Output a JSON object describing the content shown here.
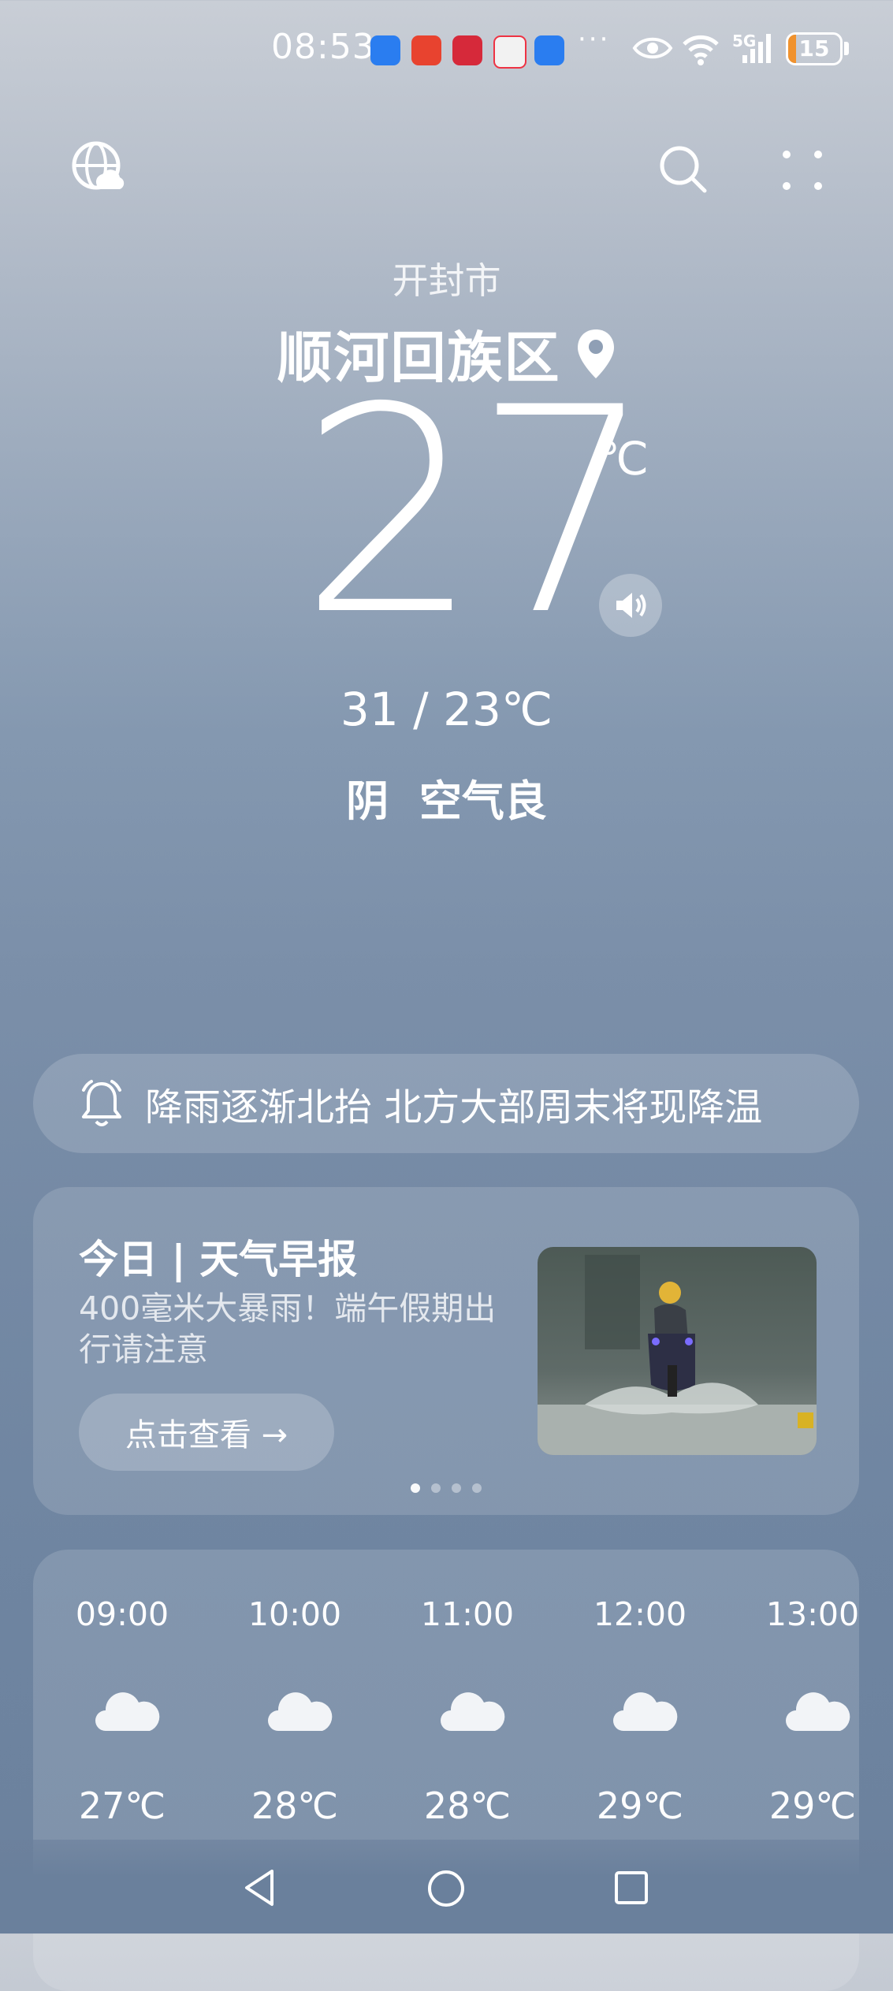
{
  "status_bar": {
    "time": "08:53",
    "more": "···",
    "network": "5G",
    "battery": "15",
    "battery_level": 0.15
  },
  "header": {
    "city": "开封市",
    "district": "顺河回族区",
    "temperature": "27",
    "temp_unit": "℃",
    "range": "31 / 23℃",
    "condition": "阴",
    "air_quality": "空气良"
  },
  "alert": {
    "text": "降雨逐渐北抬 北方大部周末将现降温"
  },
  "brief": {
    "title": "今日 | 天气早报",
    "subtitle": "400毫米大暴雨！端午假期出行请注意",
    "button": "点击查看 →",
    "page_count": 4,
    "active_page": 0
  },
  "hourly": [
    {
      "time": "09:00",
      "icon": "cloudy-icon",
      "temp": "27℃"
    },
    {
      "time": "10:00",
      "icon": "cloudy-icon",
      "temp": "28℃"
    },
    {
      "time": "11:00",
      "icon": "cloudy-icon",
      "temp": "28℃"
    },
    {
      "time": "12:00",
      "icon": "cloudy-icon",
      "temp": "29℃"
    },
    {
      "time": "13:00",
      "icon": "cloudy-icon",
      "temp": "29℃"
    }
  ],
  "colors": {
    "sky_top": "#c9ced6",
    "sky_bottom": "#6b819d",
    "battery_fill": "#f0922e"
  }
}
